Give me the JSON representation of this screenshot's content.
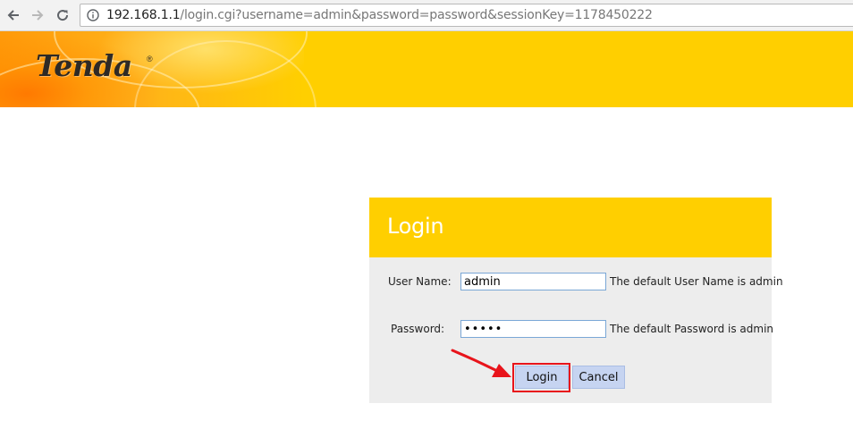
{
  "browser": {
    "address_host": "192.168.1.1",
    "address_path": "/login.cgi?username=admin&password=password&sessionKey=1178450222",
    "icons": {
      "back": "arrow-left-icon",
      "forward": "arrow-right-icon",
      "reload": "reload-icon",
      "info": "info-icon"
    }
  },
  "banner": {
    "logo_text": "Tenda",
    "logo_mark": "®",
    "color": "#ffcf00"
  },
  "login": {
    "title": "Login",
    "username_label": "User Name:",
    "username_value": "admin",
    "username_hint": "The default User Name is admin",
    "password_label": "Password:",
    "password_value": "admin",
    "password_hint": "The default Password is admin",
    "login_button": "Login",
    "cancel_button": "Cancel"
  },
  "annotation": {
    "color": "#e8141b",
    "highlighted": "login_button"
  }
}
